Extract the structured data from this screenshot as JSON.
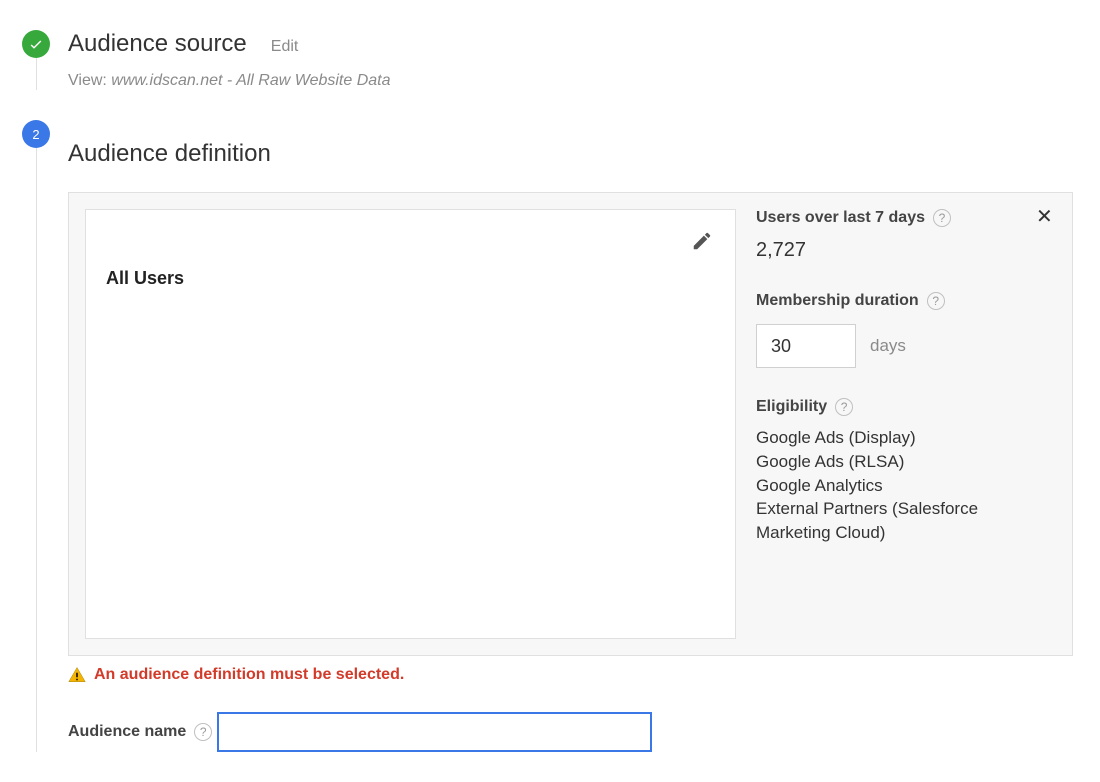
{
  "step1": {
    "title": "Audience source",
    "edit_label": "Edit",
    "view_prefix": "View: ",
    "view_value": "www.idscan.net - All Raw Website Data"
  },
  "step2": {
    "number": "2",
    "title": "Audience definition"
  },
  "definition": {
    "left_title": "All Users"
  },
  "sidebar": {
    "users_label": "Users over last 7 days",
    "users_value": "2,727",
    "membership_label": "Membership duration",
    "duration_value": "30",
    "duration_suffix": "days",
    "eligibility_label": "Eligibility",
    "eligibility_items": [
      "Google Ads (Display)",
      "Google Ads (RLSA)",
      "Google Analytics",
      "External Partners (Salesforce Marketing Cloud)"
    ]
  },
  "error": {
    "message": "An audience definition must be selected."
  },
  "audience_name": {
    "label": "Audience name",
    "value": ""
  }
}
